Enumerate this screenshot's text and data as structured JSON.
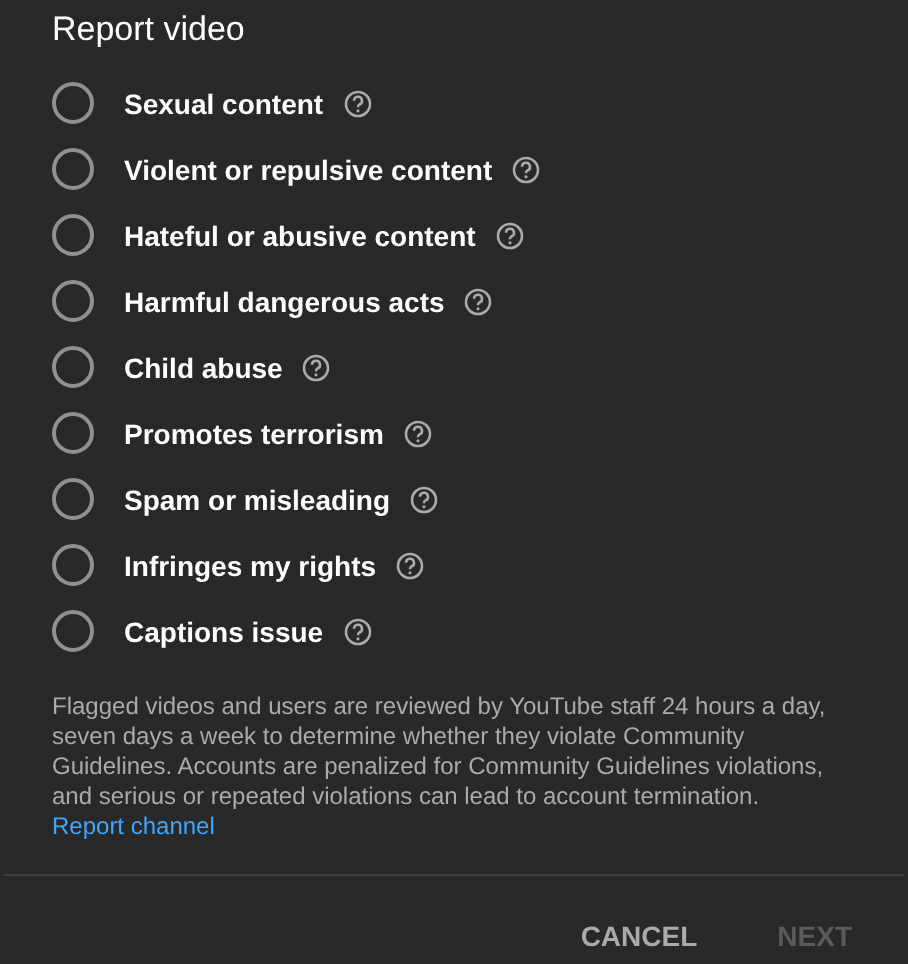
{
  "dialog": {
    "title": "Report video"
  },
  "reasons": [
    {
      "label": "Sexual content",
      "selected": false
    },
    {
      "label": "Violent or repulsive content",
      "selected": false
    },
    {
      "label": "Hateful or abusive content",
      "selected": false
    },
    {
      "label": "Harmful dangerous acts",
      "selected": false
    },
    {
      "label": "Child abuse",
      "selected": false
    },
    {
      "label": "Promotes terrorism",
      "selected": false
    },
    {
      "label": "Spam or misleading",
      "selected": false
    },
    {
      "label": "Infringes my rights",
      "selected": false
    },
    {
      "label": "Captions issue",
      "selected": false
    }
  ],
  "notice": "Flagged videos and users are reviewed by YouTube staff 24 hours a day, seven days a week to determine whether they violate Community Guidelines. Accounts are penalized for Community Guidelines violations, and serious or repeated violations can lead to account termination.",
  "link": "Report channel",
  "buttons": [
    {
      "label": "CANCEL",
      "disabled": false
    },
    {
      "label": "NEXT",
      "disabled": true
    }
  ]
}
